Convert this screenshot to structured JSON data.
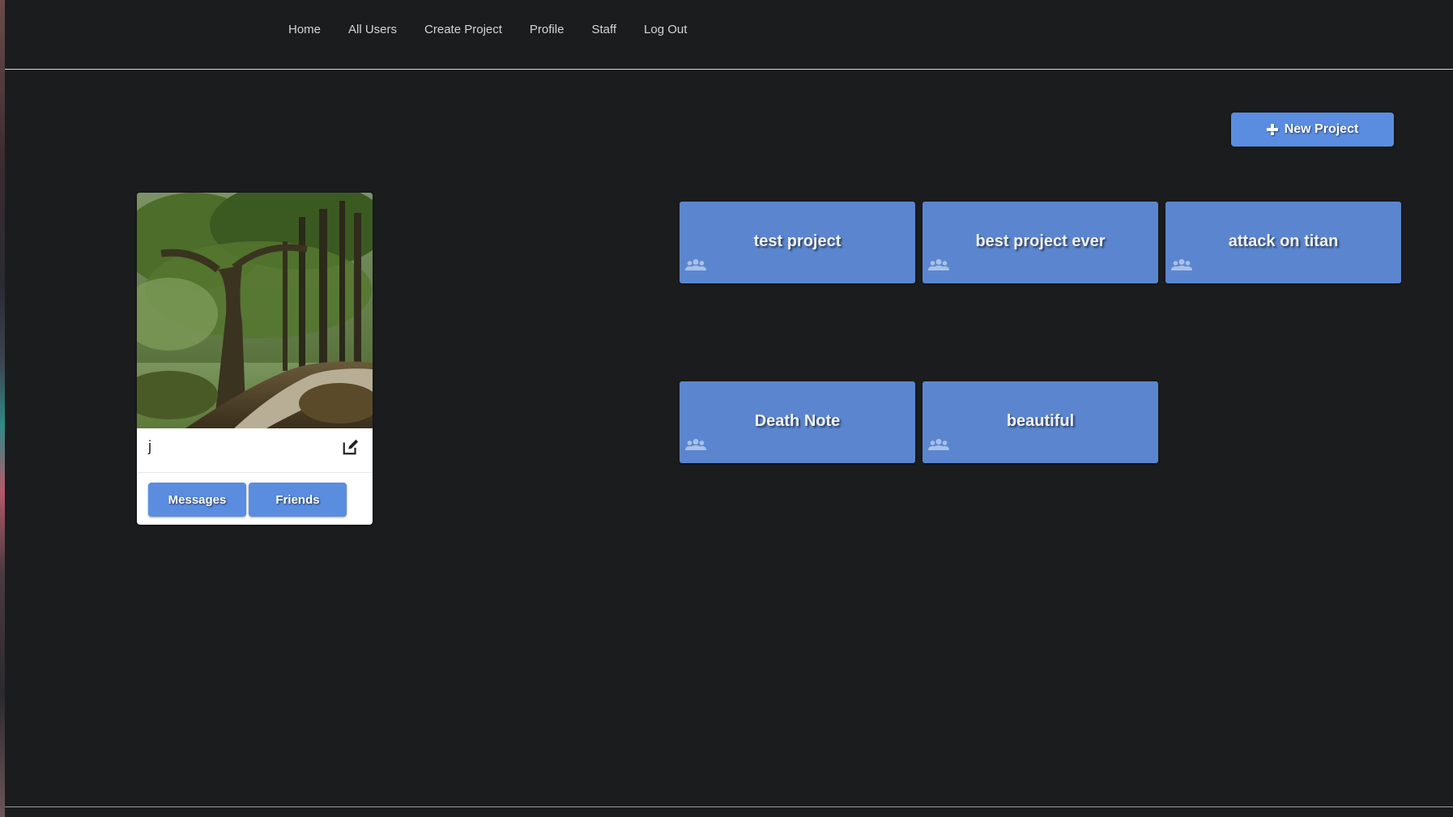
{
  "nav": {
    "links": [
      "Home",
      "All Users",
      "Create Project",
      "Profile",
      "Staff",
      "Log Out"
    ]
  },
  "new_project": {
    "label": "New Project",
    "icon": "plus-icon"
  },
  "profile": {
    "name": "j",
    "image": "forest-path-photo",
    "edit_icon": "edit-icon",
    "buttons": {
      "messages": "Messages",
      "friends": "Friends"
    }
  },
  "projects": [
    {
      "title": "test project",
      "icon": "users-icon"
    },
    {
      "title": "best project ever",
      "icon": "users-icon"
    },
    {
      "title": "attack on titan",
      "icon": "users-icon"
    },
    {
      "title": "Death Note",
      "icon": "users-icon"
    },
    {
      "title": "beautiful",
      "icon": "users-icon"
    }
  ],
  "colors": {
    "background": "#1b1c1d",
    "accent": "#5a8de0",
    "tile": "#5b86cf"
  }
}
